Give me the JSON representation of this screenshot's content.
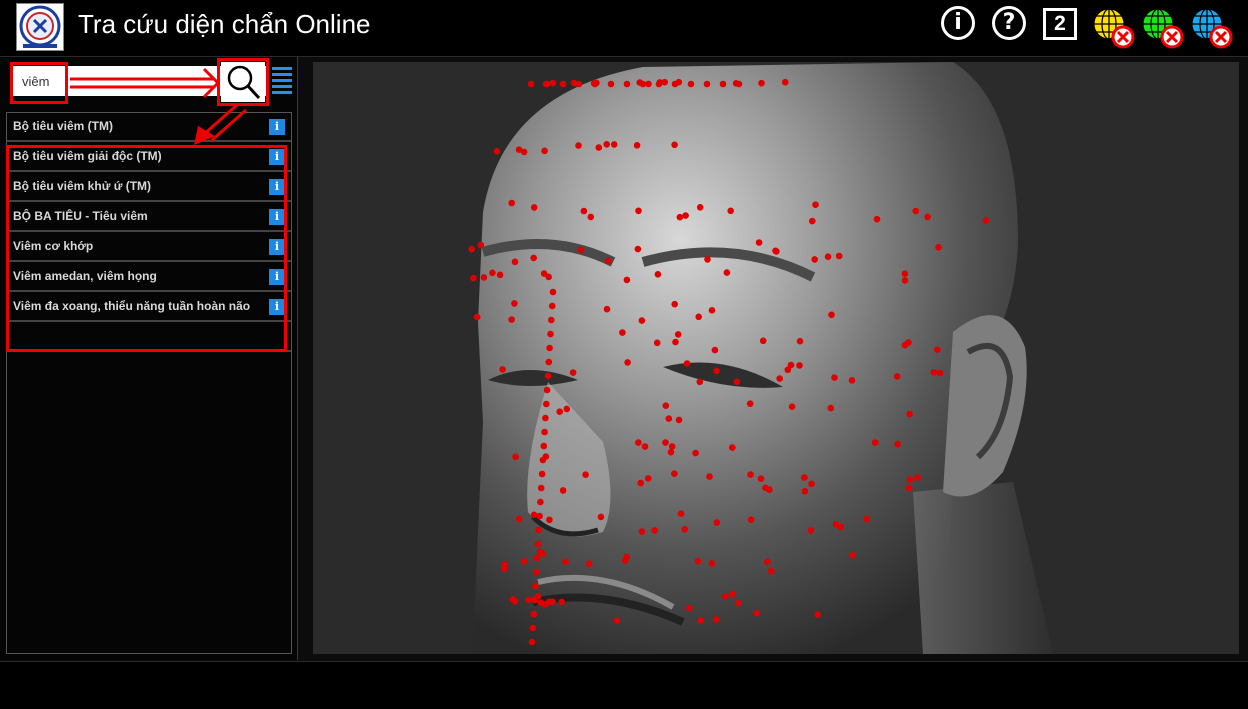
{
  "header": {
    "title": "Tra cứu diện chẩn Online",
    "info_icon": "info-icon",
    "help_icon": "help-icon",
    "count_label": "2",
    "globe_colors": [
      "#ffe000",
      "#19e619",
      "#1aa8ee"
    ]
  },
  "search": {
    "value": "viêm",
    "button_icon": "search-icon"
  },
  "results": [
    {
      "label": "Bộ tiêu viêm (TM)"
    },
    {
      "label": "Bộ tiêu viêm giải độc (TM)"
    },
    {
      "label": "Bộ tiêu viêm khử ứ (TM)"
    },
    {
      "label": "BỘ BA TIÊU - Tiêu viêm"
    },
    {
      "label": "Viêm cơ khớp"
    },
    {
      "label": "Viêm amedan, viêm họng"
    },
    {
      "label": "Viêm đa xoang, thiểu năng tuần hoàn não"
    }
  ],
  "info_glyph": "i",
  "colors": {
    "accent": "#1e88e5",
    "annotation": "#e00000",
    "point": "#e00000"
  }
}
